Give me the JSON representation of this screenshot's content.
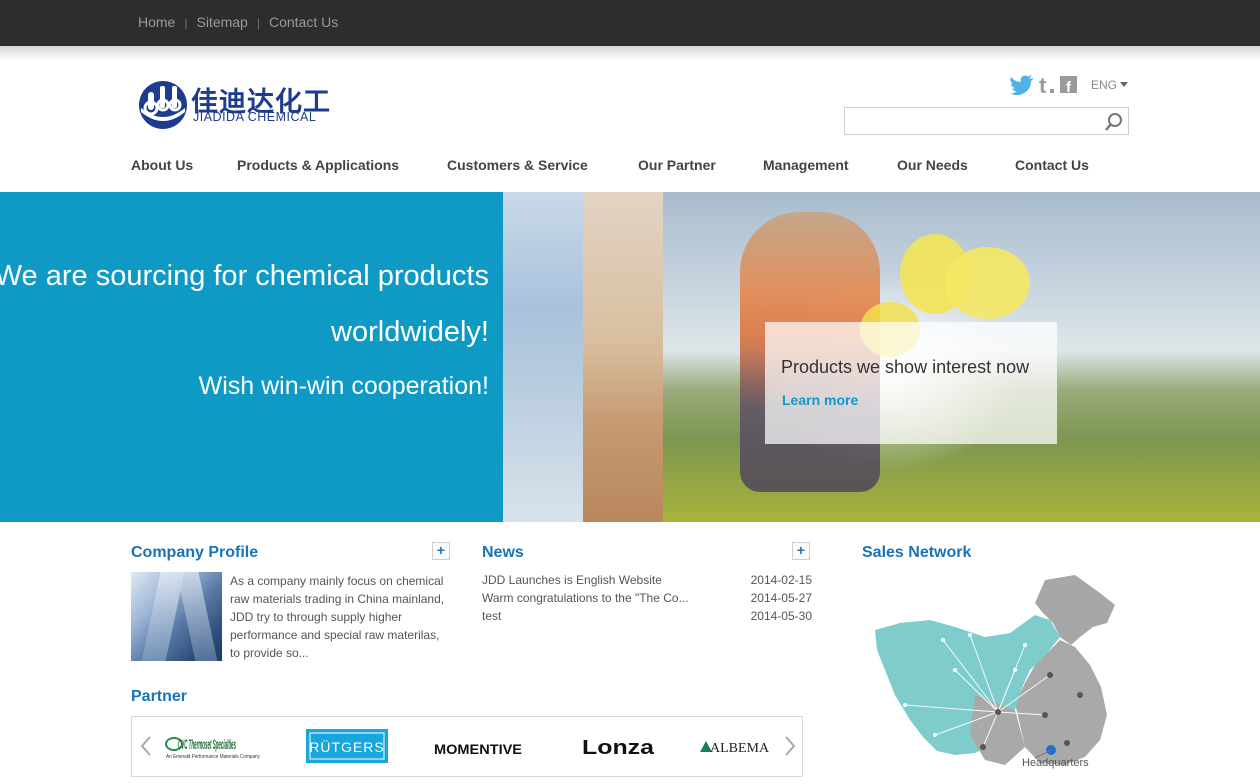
{
  "topbar": {
    "links": [
      "Home",
      "Sitemap",
      "Contact Us"
    ],
    "separator": "|"
  },
  "brand": {
    "name_cn": "佳迪达化工",
    "name_en": "JIADIDA CHEMICAL",
    "color": "#1d3b8f"
  },
  "header": {
    "social_icons": [
      "twitter-icon",
      "tumblr-icon",
      "facebook-icon"
    ],
    "language": "ENG",
    "search": {
      "value": "",
      "placeholder": ""
    }
  },
  "nav": [
    "About Us",
    "Products & Applications",
    "Customers & Service",
    "Our Partner",
    "Management",
    "Our Needs",
    "Contact Us"
  ],
  "hero": {
    "line1": "We are sourcing for chemical products",
    "line2": "worldwidely!",
    "line3": "Wish win-win cooperation!",
    "card_title": "Products we show interest now",
    "card_link": "Learn more",
    "accent": "#0f9ac6"
  },
  "company_profile": {
    "title": "Company Profile",
    "text": " As a company mainly focus on chemical raw materials trading in China mainland, JDD try to through supply higher performance and special raw materilas, to provide so..."
  },
  "news": {
    "title": "News",
    "items": [
      {
        "title": "JDD Launches is English Website",
        "date": "2014-02-15"
      },
      {
        "title": "Warm congratulations to the \"The Co...",
        "date": "2014-05-27"
      },
      {
        "title": "test",
        "date": "2014-05-30"
      }
    ]
  },
  "sales_network": {
    "title": "Sales Network",
    "map_label": "Headquarters"
  },
  "partner": {
    "title": "Partner",
    "logos": [
      "CVC Thermoset Specialties",
      "RÜTGERS",
      "MOMENTIVE",
      "Lonza",
      "ALBEMA"
    ],
    "cvc_tagline": "An Emerald Performance Materials Company"
  },
  "more_symbol": "+"
}
